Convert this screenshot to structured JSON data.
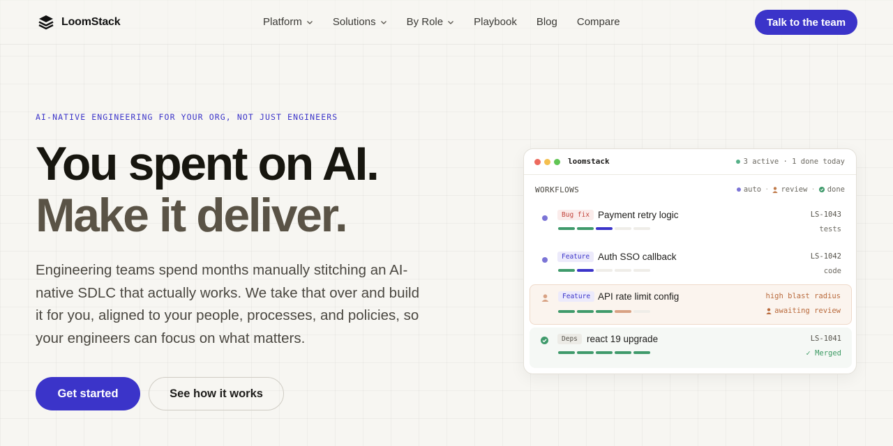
{
  "brand": {
    "name": "LoomStack"
  },
  "nav": {
    "items": [
      {
        "label": "Platform",
        "dropdown": true
      },
      {
        "label": "Solutions",
        "dropdown": true
      },
      {
        "label": "By Role",
        "dropdown": true
      },
      {
        "label": "Playbook",
        "dropdown": false
      },
      {
        "label": "Blog",
        "dropdown": false
      },
      {
        "label": "Compare",
        "dropdown": false
      }
    ],
    "cta": "Talk to the team"
  },
  "hero": {
    "eyebrow": "AI-NATIVE ENGINEERING FOR YOUR ORG, NOT JUST ENGINEERS",
    "headline_line1": "You spent on AI.",
    "headline_line2": "Make it deliver.",
    "lead": "Engineering teams spend months manually stitching an AI-native SDLC that actually works. We take that over and build it for you, aligned to your people, processes, and policies, so your engineers can focus on what matters.",
    "primary_cta": "Get started",
    "secondary_cta": "See how it works"
  },
  "card": {
    "title": "loomstack",
    "status": "3 active · 1 done today",
    "section": "WORKFLOWS",
    "legend": {
      "auto": "auto",
      "review": "review",
      "done": "done"
    },
    "colors": {
      "green": "#3f9a6b",
      "purple": "#3b34c9",
      "peach": "#d8a284",
      "empty": "#efede8"
    },
    "workflows": [
      {
        "tag": "Bug fix",
        "tag_type": "bug",
        "title": "Payment retry logic",
        "id": "LS-1043",
        "sub": "tests",
        "state": "auto",
        "progress": [
          "green",
          "green",
          "purple",
          "empty",
          "empty"
        ]
      },
      {
        "tag": "Feature",
        "tag_type": "feature",
        "title": "Auth SSO callback",
        "id": "LS-1042",
        "sub": "code",
        "state": "auto",
        "progress": [
          "green",
          "purple",
          "empty",
          "empty",
          "empty"
        ]
      },
      {
        "tag": "Feature",
        "tag_type": "feature",
        "title": "API rate limit config",
        "id": "high blast radius",
        "sub": "awaiting review",
        "state": "review",
        "progress": [
          "green",
          "green",
          "green",
          "peach",
          "empty"
        ]
      },
      {
        "tag": "Deps",
        "tag_type": "deps",
        "title": "react 19 upgrade",
        "id": "LS-1041",
        "sub": "✓ Merged",
        "state": "done",
        "progress": [
          "green",
          "green",
          "green",
          "green",
          "green"
        ]
      }
    ]
  }
}
